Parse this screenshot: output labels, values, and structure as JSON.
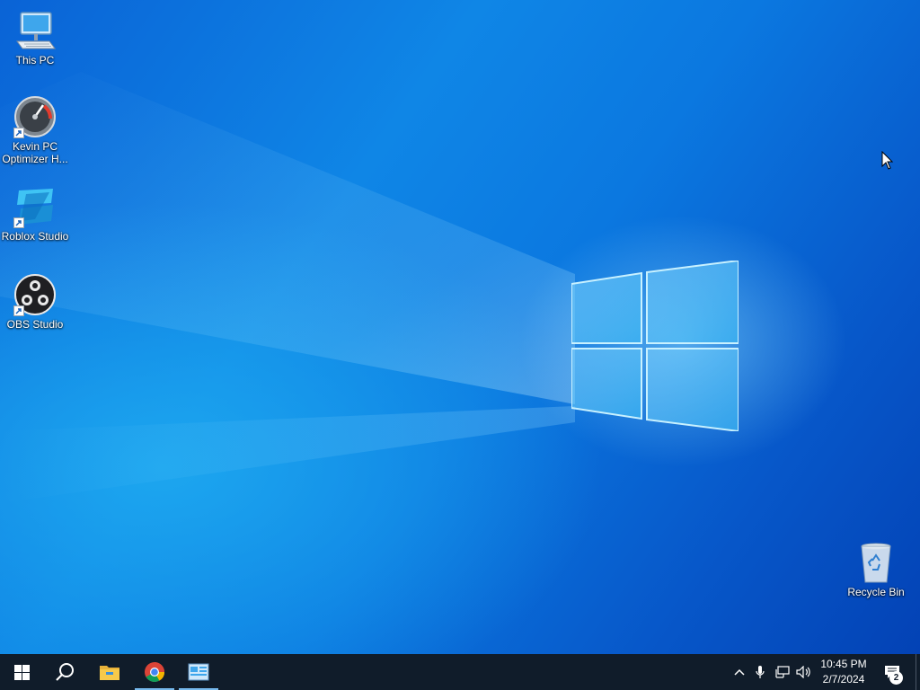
{
  "desktop": {
    "icons": [
      {
        "label": "This PC",
        "icon": "computer-icon",
        "shortcut": false
      },
      {
        "label": "Kevin PC Optimizer H...",
        "icon": "speedometer-icon",
        "shortcut": true
      },
      {
        "label": "Roblox Studio",
        "icon": "roblox-studio-icon",
        "shortcut": true
      },
      {
        "label": "OBS Studio",
        "icon": "obs-icon",
        "shortcut": true
      },
      {
        "label": "Recycle Bin",
        "icon": "recycle-bin-icon",
        "shortcut": false
      }
    ]
  },
  "taskbar": {
    "buttons": [
      {
        "icon": "windows-start-icon",
        "active": false
      },
      {
        "icon": "search-icon",
        "active": false
      },
      {
        "icon": "file-explorer-icon",
        "active": false
      },
      {
        "icon": "chrome-icon",
        "active": true
      },
      {
        "icon": "control-panel-icon",
        "active": true
      }
    ],
    "tray": {
      "icons": [
        "chevron-up-icon",
        "microphone-icon",
        "network-icon",
        "volume-icon"
      ],
      "time": "10:45 PM",
      "date": "2/7/2024",
      "notification_count": "2"
    }
  },
  "colors": {
    "taskbar_bg": "#101c2a",
    "accent": "#76b9ed",
    "desktop_blue": "#0b78e0"
  }
}
